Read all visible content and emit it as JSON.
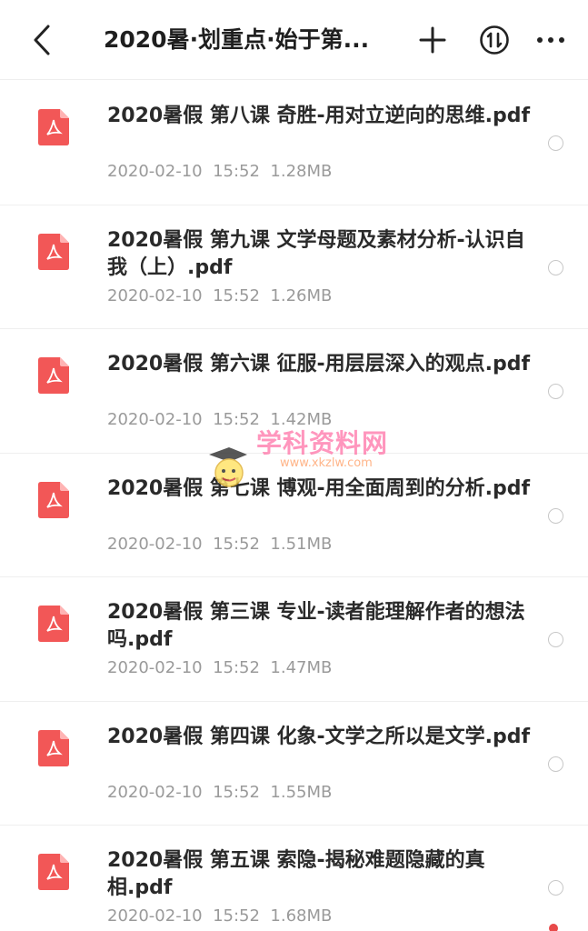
{
  "header": {
    "title": "2020暑·划重点·始于第...",
    "back_icon": "chevron-left-icon",
    "add_icon": "plus-icon",
    "sort_icon": "sort-icon",
    "more_icon": "more-dots-icon"
  },
  "watermark": {
    "text": "学科资料网",
    "url": "www.xkzlw.com"
  },
  "files": [
    {
      "name": "2020暑假 第八课 奇胜-用对立逆向的思维.pdf",
      "date": "2020-02-10",
      "time": "15:52",
      "size": "1.28MB"
    },
    {
      "name": "2020暑假 第九课 文学母题及素材分析-认识自我（上）.pdf",
      "date": "2020-02-10",
      "time": "15:52",
      "size": "1.26MB"
    },
    {
      "name": "2020暑假 第六课 征服-用层层深入的观点.pdf",
      "date": "2020-02-10",
      "time": "15:52",
      "size": "1.42MB"
    },
    {
      "name": "2020暑假 第七课 博观-用全面周到的分析.pdf",
      "date": "2020-02-10",
      "time": "15:52",
      "size": "1.51MB"
    },
    {
      "name": "2020暑假 第三课 专业-读者能理解作者的想法吗.pdf",
      "date": "2020-02-10",
      "time": "15:52",
      "size": "1.47MB"
    },
    {
      "name": "2020暑假 第四课 化象-文学之所以是文学.pdf",
      "date": "2020-02-10",
      "time": "15:52",
      "size": "1.55MB"
    },
    {
      "name": "2020暑假 第五课 索隐-揭秘难题隐藏的真相.pdf",
      "date": "2020-02-10",
      "time": "15:52",
      "size": "1.68MB"
    }
  ],
  "colors": {
    "pdf_red": "#f25757",
    "meta_gray": "#9a9a9a"
  }
}
